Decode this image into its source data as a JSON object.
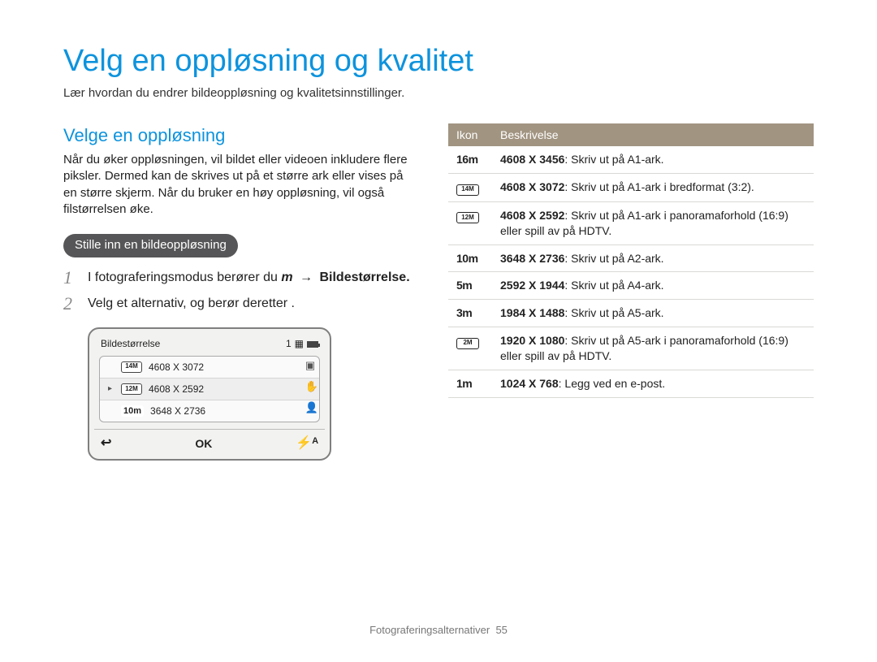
{
  "page": {
    "title": "Velg en oppløsning og kvalitet",
    "subtitle": "Lær hvordan du endrer bildeoppløsning og kvalitetsinnstillinger.",
    "footer_section": "Fotograferingsalternativer",
    "page_number": "55"
  },
  "left": {
    "heading": "Velge en oppløsning",
    "body": "Når du øker oppløsningen, vil bildet eller videoen inkludere flere piksler. Dermed kan de skrives ut på et større ark eller vises på en større skjerm. Når du bruker en høy oppløsning, vil også filstørrelsen øke.",
    "pill": "Stille inn en bildeoppløsning",
    "steps": [
      {
        "num": "1",
        "prefix": "I fotograferingsmodus berører du ",
        "var": "m",
        "arrow": "→",
        "suffix": "Bildestørrelse."
      },
      {
        "num": "2",
        "prefix": "Velg et alternativ, og berør deretter ",
        "var": "",
        "arrow": "",
        "suffix": "."
      }
    ],
    "camera": {
      "title": "Bildestørrelse",
      "counter": "1",
      "items": [
        {
          "icon": "14M",
          "icon_style": "box wide",
          "label": "4608 X 3072",
          "selected": false
        },
        {
          "icon": "12M",
          "icon_style": "box wide",
          "label": "4608 X 2592",
          "selected": true
        },
        {
          "icon": "10m",
          "icon_style": "m",
          "label": "3648 X 2736",
          "selected": false
        }
      ],
      "ok_label": "OK",
      "back_glyph": "↩",
      "flash_glyph": "⚡ᴬ"
    }
  },
  "right": {
    "headers": {
      "icon": "Ikon",
      "desc": "Beskrivelse"
    },
    "rows": [
      {
        "icon": "16m",
        "icon_style": "m",
        "res": "4608 X 3456",
        "text": ": Skriv ut på A1-ark."
      },
      {
        "icon": "14M",
        "icon_style": "box wide",
        "res": "4608 X 3072",
        "text": ": Skriv ut på A1-ark i bredformat (3:2)."
      },
      {
        "icon": "12M",
        "icon_style": "box wide",
        "res": "4608 X 2592",
        "text": ": Skriv ut på A1-ark i panoramaforhold (16:9) eller spill av på HDTV."
      },
      {
        "icon": "10m",
        "icon_style": "m",
        "res": "3648 X 2736",
        "text": ": Skriv ut på A2-ark."
      },
      {
        "icon": "5m",
        "icon_style": "m",
        "res": "2592 X 1944",
        "text": ": Skriv ut på A4-ark."
      },
      {
        "icon": "3m",
        "icon_style": "m",
        "res": "1984 X 1488",
        "text": ": Skriv ut på A5-ark."
      },
      {
        "icon": "2M",
        "icon_style": "box wide",
        "res": "1920 X 1080",
        "text": ": Skriv ut på A5-ark i panoramaforhold (16:9) eller spill av på HDTV."
      },
      {
        "icon": "1m",
        "icon_style": "m",
        "res": "1024 X 768",
        "text": ": Legg ved en e-post."
      }
    ]
  }
}
